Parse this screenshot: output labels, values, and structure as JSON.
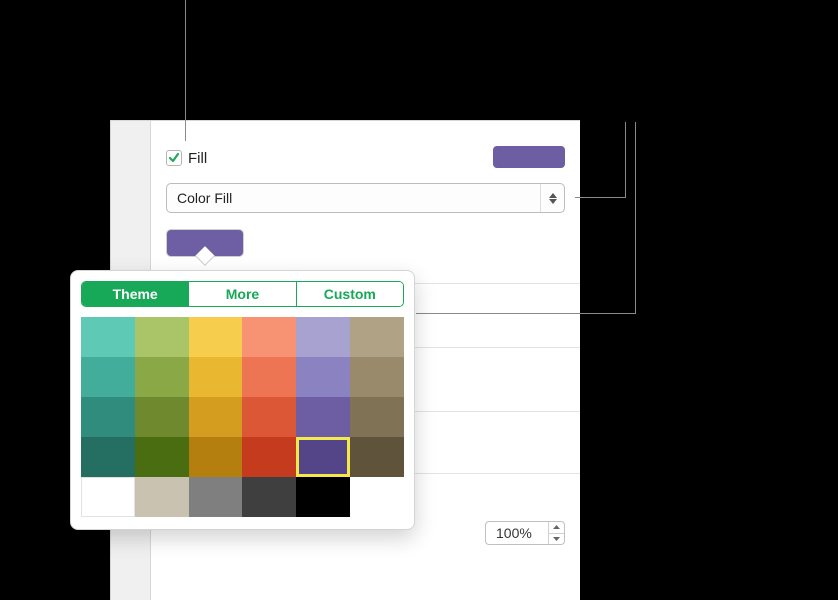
{
  "fill_section": {
    "checkbox_checked": true,
    "label": "Fill",
    "swatch_color": "#6d5da3"
  },
  "dropdown": {
    "value": "Color Fill"
  },
  "color_well": {
    "color": "#6e5ea4"
  },
  "segmented": {
    "items": [
      "Theme",
      "More",
      "Custom"
    ],
    "active_index": 0
  },
  "opacity": {
    "value": "100%"
  },
  "palette": {
    "selected": [
      3,
      4
    ],
    "rows": [
      [
        "#5ec9b5",
        "#aac568",
        "#f6cd4c",
        "#f79273",
        "#a8a2d1",
        "#b0a285"
      ],
      [
        "#42ad9a",
        "#8aa845",
        "#eab731",
        "#ed7554",
        "#8a82c1",
        "#998a6c"
      ],
      [
        "#308d7d",
        "#6f8a2e",
        "#d49d1f",
        "#dc5736",
        "#6d5da3",
        "#7f7255"
      ],
      [
        "#256e62",
        "#4b6d12",
        "#b47f0f",
        "#c43c1d",
        "#544588",
        "#5f533c"
      ],
      [
        "#ffffff",
        "#c9c2b0",
        "#7f7f7f",
        "#3f3f3f",
        "#000000",
        "#ffffff00"
      ]
    ]
  }
}
